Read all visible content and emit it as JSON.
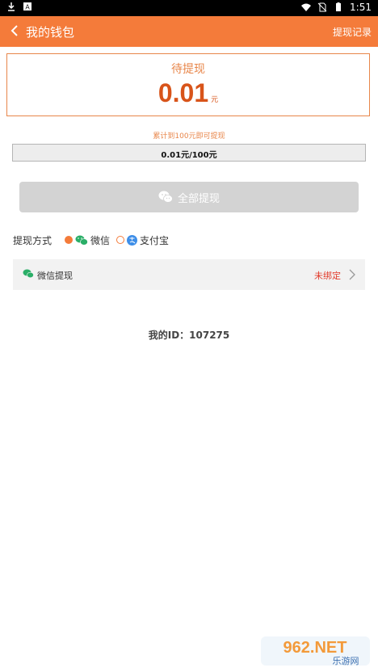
{
  "status_bar": {
    "time": "1:51"
  },
  "header": {
    "title": "我的钱包",
    "right_link": "提现记录"
  },
  "balance": {
    "label": "待提现",
    "amount": "0.01",
    "unit": "元"
  },
  "hint": "累计到100元即可提现",
  "progress": {
    "text": "0.01元/100元",
    "fraction": 0.0001
  },
  "withdraw_button": {
    "label": "全部提现"
  },
  "method": {
    "label": "提现方式",
    "options": [
      {
        "label": "微信",
        "selected": true
      },
      {
        "label": "支付宝",
        "selected": false
      }
    ]
  },
  "wechat_row": {
    "label": "微信提现",
    "status": "未绑定"
  },
  "user_id": {
    "text": "我的ID：107275"
  },
  "watermark": {
    "text_top": "962.NET",
    "text_bottom": "乐游网"
  },
  "colors": {
    "accent": "#f47b3a",
    "amount": "#d8541a",
    "status_red": "#e23a2a",
    "wechat_green": "#2aae67",
    "alipay_blue": "#3d8ee8"
  }
}
